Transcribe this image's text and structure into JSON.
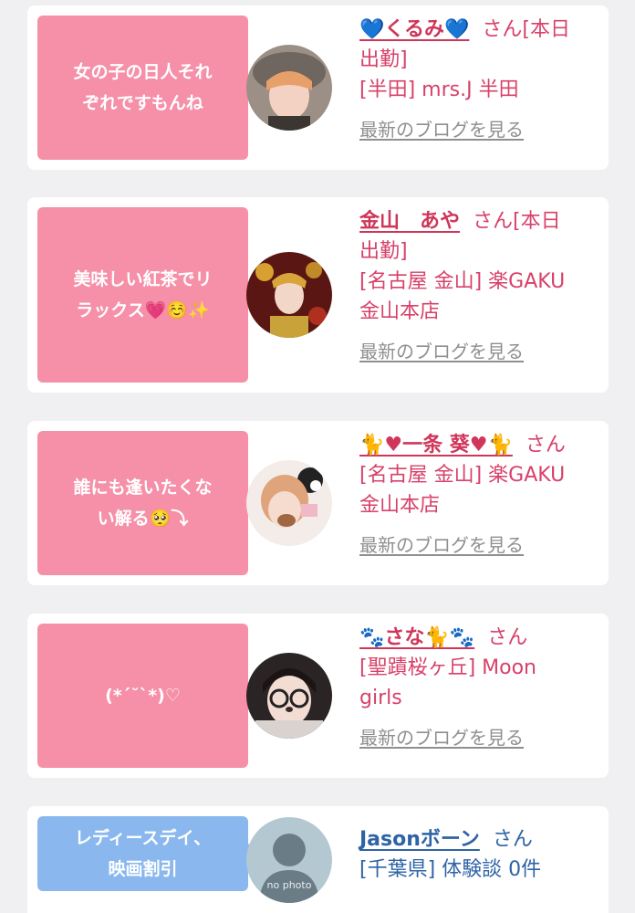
{
  "cards": [
    {
      "bubble_lines": [
        "女の子の日人それ",
        "ぞれですもんね"
      ],
      "name": "💙くるみ💙",
      "san": "さん",
      "status": "[本日",
      "status2": "出勤]",
      "shop": "[半田] mrs.J 半田",
      "shop2": "",
      "blog": "最新のブログを見る",
      "theme": "pink"
    },
    {
      "bubble_lines": [
        "美味しい紅茶でリ",
        "ラックス💗☺️✨"
      ],
      "name": "金山　あや",
      "san": "さん",
      "status": "[本日",
      "status2": "出勤]",
      "shop": "[名古屋 金山] 楽GAKU",
      "shop2": "金山本店",
      "blog": "最新のブログを見る",
      "theme": "pink"
    },
    {
      "bubble_lines": [
        "誰にも逢いたくな",
        "い解る🥺⤵"
      ],
      "name": "🐈♥一条 葵♥🐈",
      "san": "さん",
      "status": "",
      "status2": "",
      "shop": "[名古屋 金山] 楽GAKU",
      "shop2": "金山本店",
      "blog": "最新のブログを見る",
      "theme": "pink"
    },
    {
      "bubble_lines": [
        "(*´˘`*)♡"
      ],
      "name": "🐾さな🐈🐾",
      "san": "さん",
      "status": "",
      "status2": "",
      "shop": "[聖蹟桜ヶ丘] Moon",
      "shop2": "girls",
      "blog": "最新のブログを見る",
      "theme": "pink"
    },
    {
      "bubble_lines": [
        "レディースデイ、",
        "映画割引"
      ],
      "name": "Jasonボーン",
      "san": "さん",
      "status": "",
      "status2": "",
      "shop": "[千葉県] 体験談 0件",
      "shop2": "",
      "blog": "",
      "avatar_text": "no photo",
      "theme": "blue"
    }
  ],
  "colors": {
    "pink_bubble": "#f590a8",
    "blue_bubble": "#8ab8ee",
    "pink_text": "#d8416a",
    "blue_text": "#2e64a6",
    "link_gray": "#8f8f8f"
  }
}
